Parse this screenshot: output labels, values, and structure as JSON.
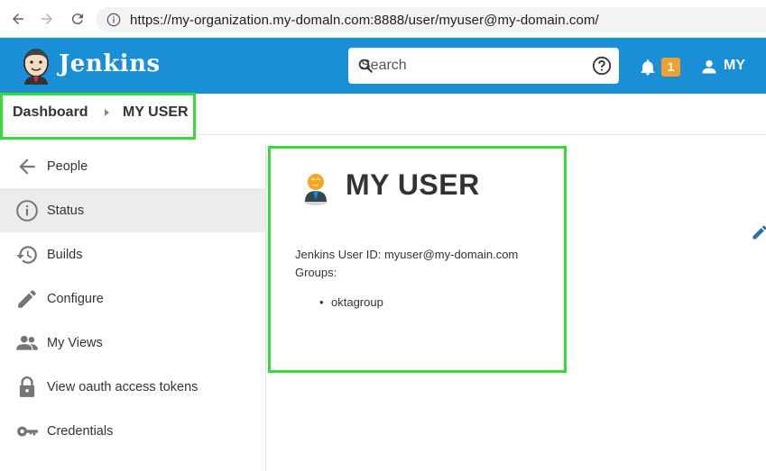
{
  "browser": {
    "url": "https://my-organization.my-domaln.com:8888/user/myuser@my-domain.com/",
    "icons": [
      "back-icon",
      "forward-icon",
      "reload-icon",
      "site-info-icon"
    ]
  },
  "header": {
    "brand": "Jenkins",
    "search_placeholder": "Search",
    "notification_count": "1",
    "user_label": "MY",
    "accent_color": "#1a8fd6",
    "badge_color": "#f0a030"
  },
  "breadcrumb": {
    "items": [
      "Dashboard",
      "MY USER"
    ],
    "highlight_color": "#33dd33"
  },
  "sidebar": {
    "items": [
      {
        "label": "People",
        "icon": "arrow-left-icon",
        "active": false
      },
      {
        "label": "Status",
        "icon": "info-icon",
        "active": true
      },
      {
        "label": "Builds",
        "icon": "history-icon",
        "active": false
      },
      {
        "label": "Configure",
        "icon": "pencil-icon",
        "active": false
      },
      {
        "label": "My Views",
        "icon": "people-icon",
        "active": false
      },
      {
        "label": "View oauth access tokens",
        "icon": "lock-icon",
        "active": false
      },
      {
        "label": "Credentials",
        "icon": "key-icon",
        "active": false
      }
    ]
  },
  "main": {
    "title": "MY USER",
    "user_id_line": "Jenkins User ID: myuser@my-domain.com",
    "groups_label": "Groups:",
    "groups": [
      "oktagroup"
    ],
    "edit_icon": "edit-pencil-icon"
  }
}
